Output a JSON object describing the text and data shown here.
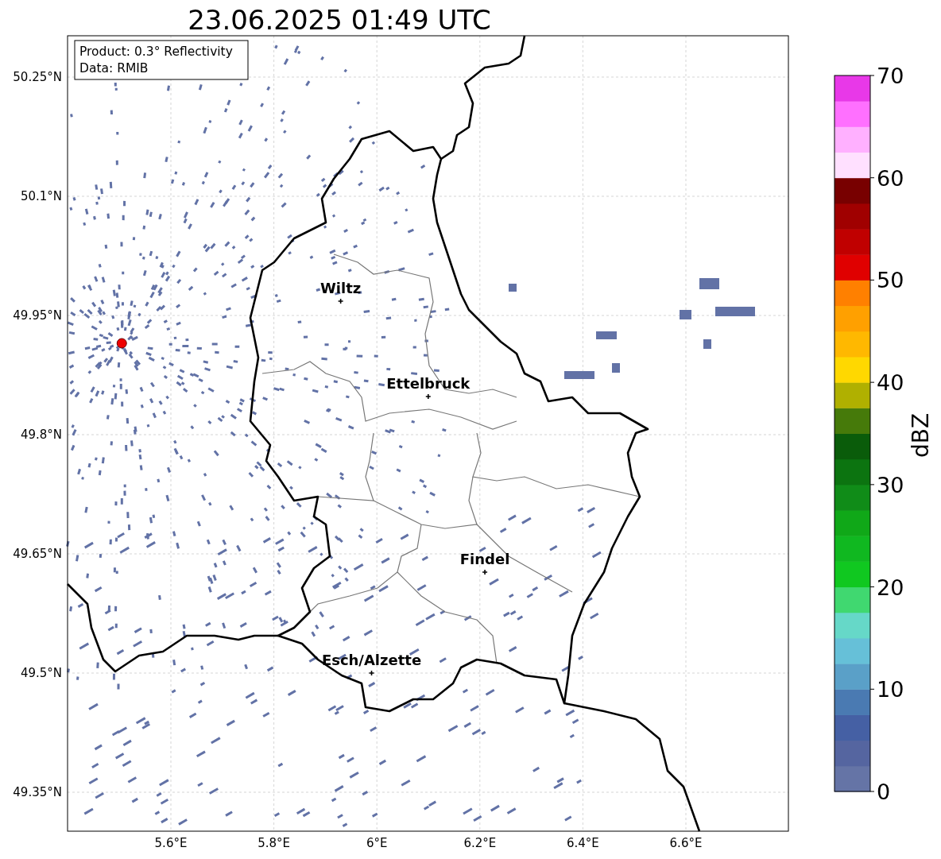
{
  "title": "23.06.2025 01:49 UTC",
  "info_box": [
    "Product: 0.3° Reflectivity",
    "Data: RMIB"
  ],
  "map": {
    "lat_ticks": [
      "50.25°N",
      "50.1°N",
      "49.95°N",
      "49.8°N",
      "49.65°N",
      "49.5°N",
      "49.35°N"
    ],
    "lon_ticks": [
      "5.6°E",
      "5.8°E",
      "6°E",
      "6.2°E",
      "6.4°E",
      "6.6°E"
    ],
    "cities": [
      "Wiltz",
      "Ettelbruck",
      "Findel",
      "Esch/Alzette"
    ]
  },
  "colorbar": {
    "label": "dBZ",
    "ticks": [
      "70",
      "60",
      "50",
      "40",
      "30",
      "20",
      "10",
      "0"
    ],
    "bins": [
      {
        "color": "#6574a6"
      },
      {
        "color": "#5565a0"
      },
      {
        "color": "#4560a4"
      },
      {
        "color": "#4a7ab2"
      },
      {
        "color": "#5aa0c8"
      },
      {
        "color": "#66c0d8"
      },
      {
        "color": "#66d8c8"
      },
      {
        "color": "#40d870"
      },
      {
        "color": "#10c820"
      },
      {
        "color": "#10b820"
      },
      {
        "color": "#10a818"
      },
      {
        "color": "#108c18"
      },
      {
        "color": "#0c7410"
      },
      {
        "color": "#0a5c0a"
      },
      {
        "color": "#467a0a"
      },
      {
        "color": "#b0b000"
      },
      {
        "color": "#ffd800"
      },
      {
        "color": "#ffb800"
      },
      {
        "color": "#ffa000"
      },
      {
        "color": "#ff8000"
      },
      {
        "color": "#e00000"
      },
      {
        "color": "#c00000"
      },
      {
        "color": "#a00000"
      },
      {
        "color": "#780000"
      },
      {
        "color": "#ffe0ff"
      },
      {
        "color": "#ffb0ff"
      },
      {
        "color": "#ff70ff"
      },
      {
        "color": "#e838e8"
      }
    ]
  }
}
